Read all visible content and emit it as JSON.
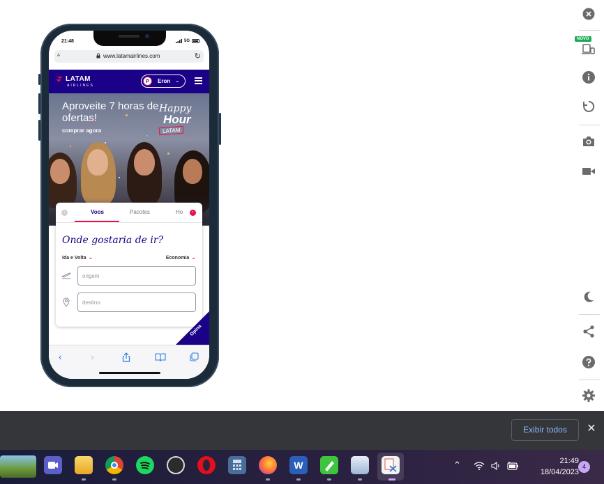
{
  "phone": {
    "status_time": "21:48",
    "status_signal": "5G",
    "url_aa": "A",
    "url": "www.latamairlines.com"
  },
  "latam": {
    "brand": "LATAM",
    "brand_sub": "AIRLINES",
    "user_initial": "P",
    "user_name": "Eron",
    "hero_title": "Aproveite 7 horas de ofertas!",
    "hero_cta": "comprar agora",
    "promo_line1": "Happy",
    "promo_line2": "Hour",
    "promo_line3": "LATAM",
    "tabs": [
      "Voos",
      "Pacotes",
      "Ho"
    ],
    "search_title": "Onde gostaria de ir?",
    "trip_type": "Ida e Volta",
    "cabin": "Economia",
    "origin_placeholder": "origem",
    "destination_placeholder": "destino",
    "feedback": "Opina"
  },
  "toolbar": {
    "novo_badge": "NOVO"
  },
  "downloads": {
    "show_all": "Exibir todos"
  },
  "taskbar": {
    "time": "21:49",
    "date": "18/04/2023",
    "notifications": "4",
    "word_letter": "W"
  },
  "colors": {
    "latam_indigo": "#1b0088",
    "latam_coral": "#e8114b",
    "link_blue": "#8ab4f8"
  }
}
